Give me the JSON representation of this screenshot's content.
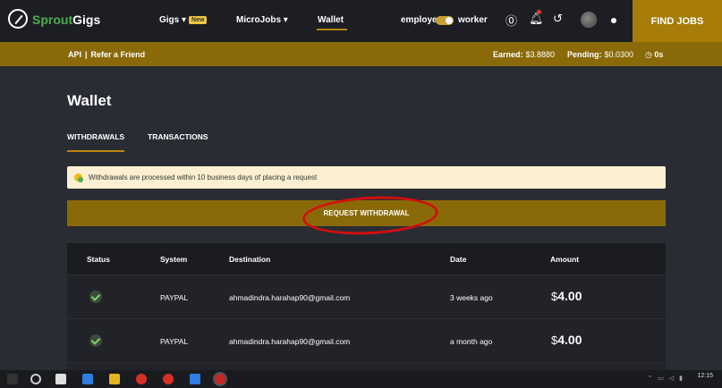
{
  "header": {
    "brand_part1": "Sprout",
    "brand_part2": "Gigs",
    "nav": [
      {
        "label": "Gigs ▾",
        "badge": "New"
      },
      {
        "label": "MicroJobs ▾"
      },
      {
        "label": "Wallet"
      }
    ],
    "mode_employer": "employer",
    "mode_worker": "worker",
    "find_jobs": "FIND JOBS",
    "icons": [
      "help-icon",
      "bell-icon",
      "history-icon",
      "avatar",
      "dot-menu-icon"
    ]
  },
  "subbar": {
    "api": "API",
    "separator": "|",
    "refer": "Refer a Friend",
    "earned_label": "Earned:",
    "earned_value": "$3.8880",
    "pending_label": "Pending:",
    "pending_value": "$0.0300",
    "timer": "0s"
  },
  "main": {
    "title": "Wallet",
    "tabs": [
      {
        "label": "WITHDRAWALS",
        "active": true
      },
      {
        "label": "TRANSACTIONS",
        "active": false
      }
    ],
    "notice": "Withdrawals are processed within 10 business days of placing a request",
    "request_button": "REQUEST WITHDRAWAL"
  },
  "table": {
    "columns": [
      "Status",
      "System",
      "Destination",
      "Date",
      "Amount"
    ],
    "rows": [
      {
        "status": "completed",
        "system": "PAYPAL",
        "destination": "ahmadindra.harahap90@gmail.com",
        "date": "3 weeks ago",
        "currency": "$",
        "amount": "4.00"
      },
      {
        "status": "completed",
        "system": "PAYPAL",
        "destination": "ahmadindra.harahap90@gmail.com",
        "date": "a month ago",
        "currency": "$",
        "amount": "4.00"
      }
    ]
  },
  "taskbar": {
    "clock": "12:15"
  },
  "colors": {
    "gold": "#8a6a08",
    "find_jobs": "#a77c08",
    "annotation_red": "#d10f0f",
    "notice_bg": "#fbf0d2"
  }
}
